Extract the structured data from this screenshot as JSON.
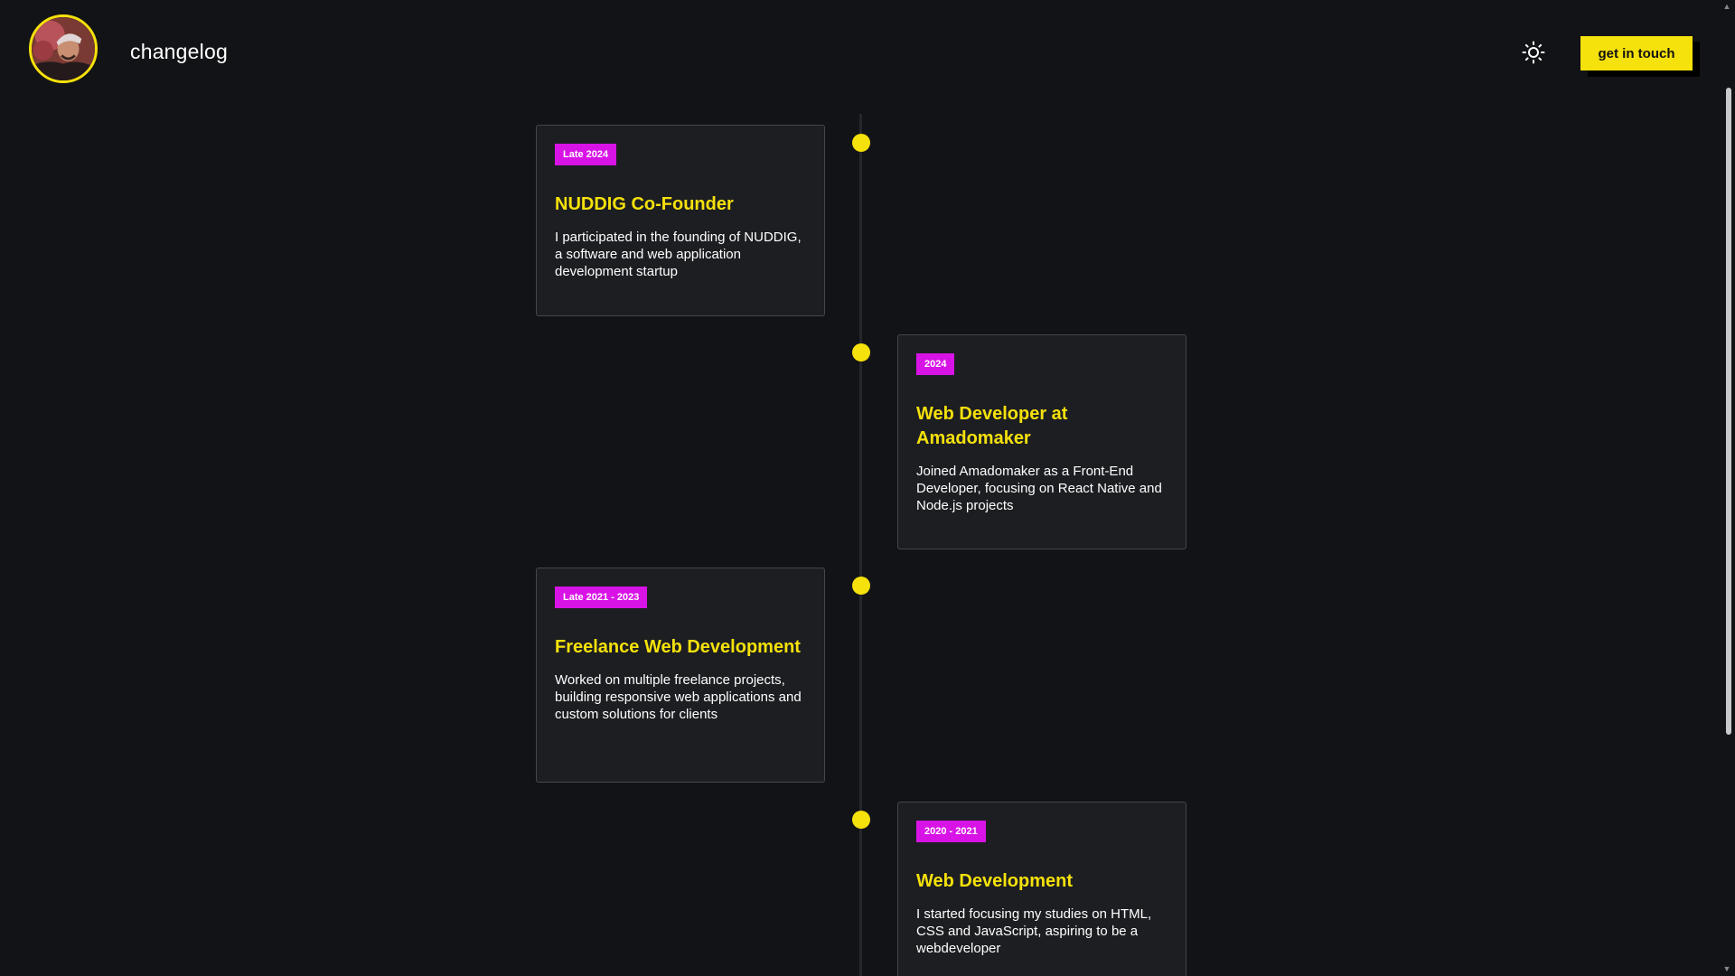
{
  "header": {
    "site_title": "changelog",
    "cta_label": "get in touch",
    "theme_icon": "sun-icon",
    "avatar": "profile-photo"
  },
  "colors": {
    "background": "#121316",
    "card": "#1d1e22",
    "accent": "#f5e10b",
    "badge": "#d813e6",
    "timeline_line": "#26272b"
  },
  "timeline": [
    {
      "period": "Late 2024",
      "title": "NUDDIG Co-Founder",
      "description": "I participated in the founding of NUDDIG, a software and web application development startup"
    },
    {
      "period": "2024",
      "title": "Web Developer at Amadomaker",
      "description": "Joined Amadomaker as a Front-End Developer, focusing on React Native and Node.js projects"
    },
    {
      "period": "Late 2021 - 2023",
      "title": "Freelance Web Development",
      "description": "Worked on multiple freelance projects, building responsive web applications and custom solutions for clients"
    },
    {
      "period": "2020 - 2021",
      "title": "Web Development",
      "description": "I started focusing my studies on HTML, CSS and JavaScript, aspiring to be a webdeveloper"
    }
  ]
}
